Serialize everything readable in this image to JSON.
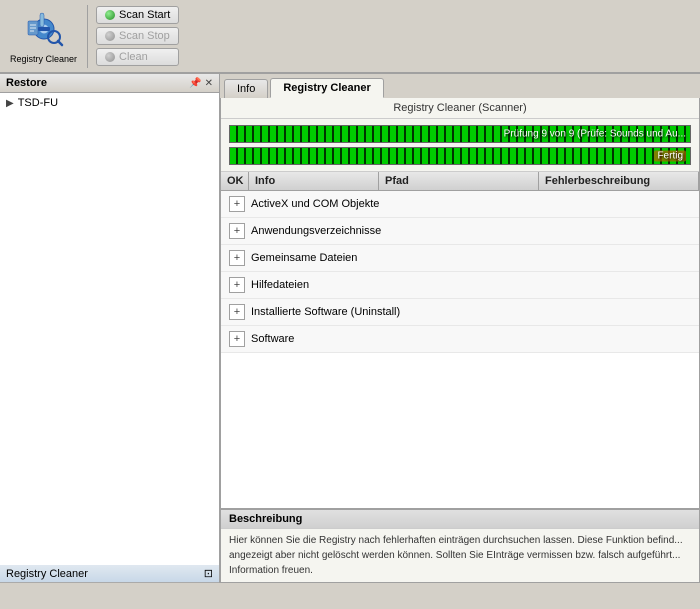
{
  "app": {
    "title": "Registry Cleaner"
  },
  "toolbar": {
    "scan_start_label": "Scan Start",
    "scan_stop_label": "Scan Stop",
    "clean_label": "Clean"
  },
  "sidebar": {
    "header": "Restore",
    "items": [
      {
        "label": "TSD-FU"
      }
    ],
    "registry_label": "Registry Cleaner"
  },
  "tabs": [
    {
      "label": "Info"
    },
    {
      "label": "Registry Cleaner"
    }
  ],
  "scanner": {
    "title": "Registry Cleaner (Scanner)",
    "progress1_label": "Prüfung 9 von 9 (Prüfe: Sounds und Au...",
    "progress2_label": "Fertig"
  },
  "table": {
    "columns": [
      "OK",
      "Info",
      "Pfad",
      "Fehlerbeschreibung"
    ],
    "items": [
      {
        "label": "ActiveX und COM Objekte"
      },
      {
        "label": "Anwendungsverzeichnisse"
      },
      {
        "label": "Gemeinsame Dateien"
      },
      {
        "label": "Hilfedateien"
      },
      {
        "label": "Installierte Software (Uninstall)"
      },
      {
        "label": "Software"
      }
    ]
  },
  "description": {
    "title": "Beschreibung",
    "text": "Hier können Sie die Registry nach fehlerhaften einträgen durchsuchen lassen. Diese Funktion befind... angezeigt aber nicht gelöscht werden können. Sollten Sie EInträge vermissen bzw. falsch aufgeführt... Information freuen."
  }
}
